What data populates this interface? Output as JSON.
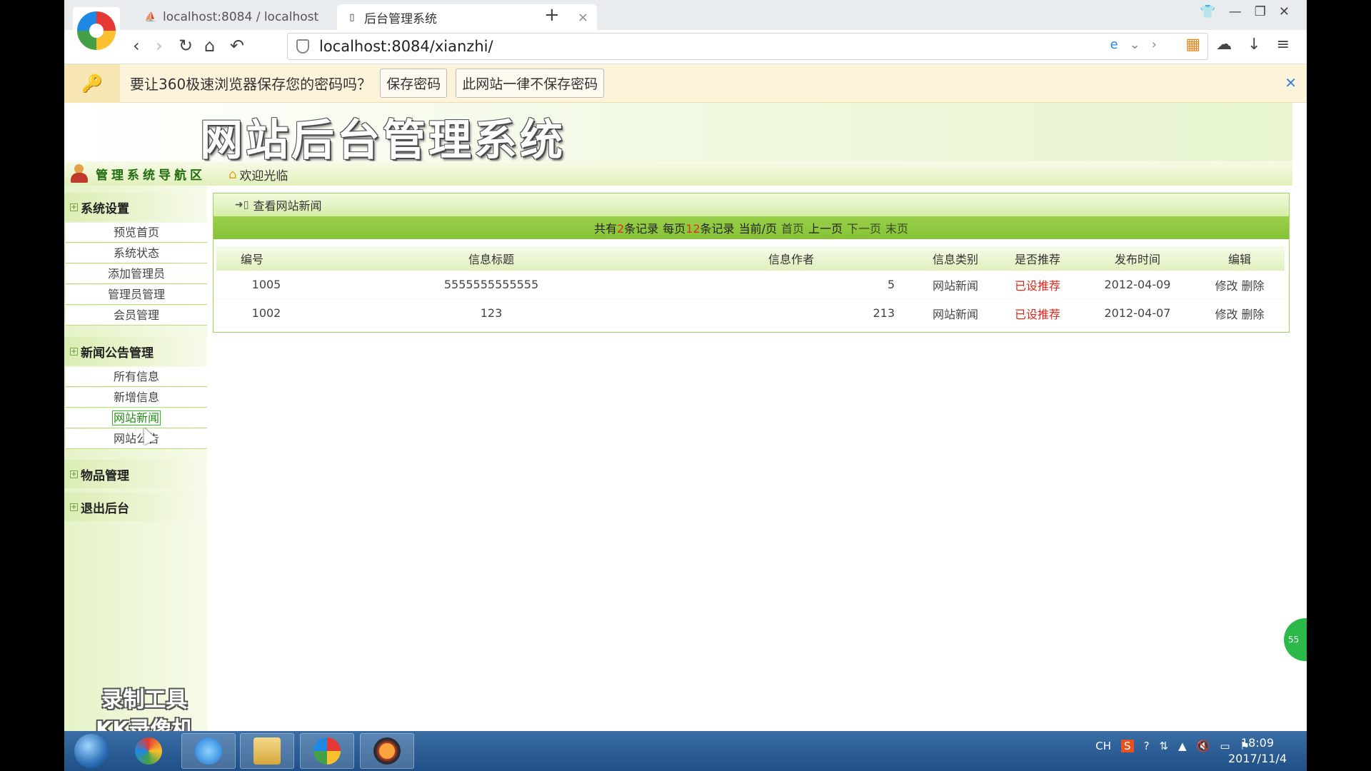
{
  "browser": {
    "tabs": [
      {
        "title": "localhost:8084 / localhost"
      },
      {
        "title": "后台管理系统"
      }
    ],
    "new_tab": "+",
    "address": "localhost:8084/xianzhi/"
  },
  "password_bar": {
    "message": "要让360极速浏览器保存您的密码吗？",
    "save_label": "保存密码",
    "never_label": "此网站一律不保存密码",
    "close": "✕"
  },
  "header": {
    "site_title": "网站后台管理系统",
    "nav_area_title": "管理系统导航区",
    "welcome": "欢迎光临"
  },
  "sidebar": {
    "sections": [
      {
        "title": "系统设置",
        "items": [
          "预览首页",
          "系统状态",
          "添加管理员",
          "管理员管理",
          "会员管理"
        ]
      },
      {
        "title": "新闻公告管理",
        "items": [
          "所有信息",
          "新增信息",
          "网站新闻",
          "网站公告"
        ]
      },
      {
        "title": "物品管理"
      },
      {
        "title": "退出后台"
      }
    ]
  },
  "main": {
    "title": "查看网站新闻",
    "pager": {
      "total_prefix": "共有",
      "total": "2",
      "total_suffix": "条记录",
      "per_page_prefix": "每页",
      "per_page": "12",
      "per_page_suffix": "条记录",
      "current": "当前/页",
      "first": "首页",
      "prev": "上一页",
      "next": "下一页",
      "last": "末页"
    },
    "columns": [
      "编号",
      "信息标题",
      "信息作者",
      "信息类别",
      "是否推荐",
      "发布时间",
      "编辑"
    ],
    "rows": [
      {
        "id": "1005",
        "title": "5555555555555",
        "author": "5",
        "category": "网站新闻",
        "recommend": "已设推荐",
        "date": "2012-04-09",
        "edit": "修改",
        "delete": "删除"
      },
      {
        "id": "1002",
        "title": "123",
        "author": "213",
        "category": "网站新闻",
        "recommend": "已设推荐",
        "date": "2012-04-07",
        "edit": "修改",
        "delete": "删除"
      }
    ]
  },
  "watermark": {
    "line1": "录制工具",
    "line2": "KK录像机"
  },
  "float_ball": "55",
  "tray": {
    "lang": "CH"
  },
  "clock": {
    "time": "18:09",
    "date": "2017/11/4"
  },
  "colors": {
    "accent_green": "#85c235",
    "recommend_red": "#e3261b"
  }
}
